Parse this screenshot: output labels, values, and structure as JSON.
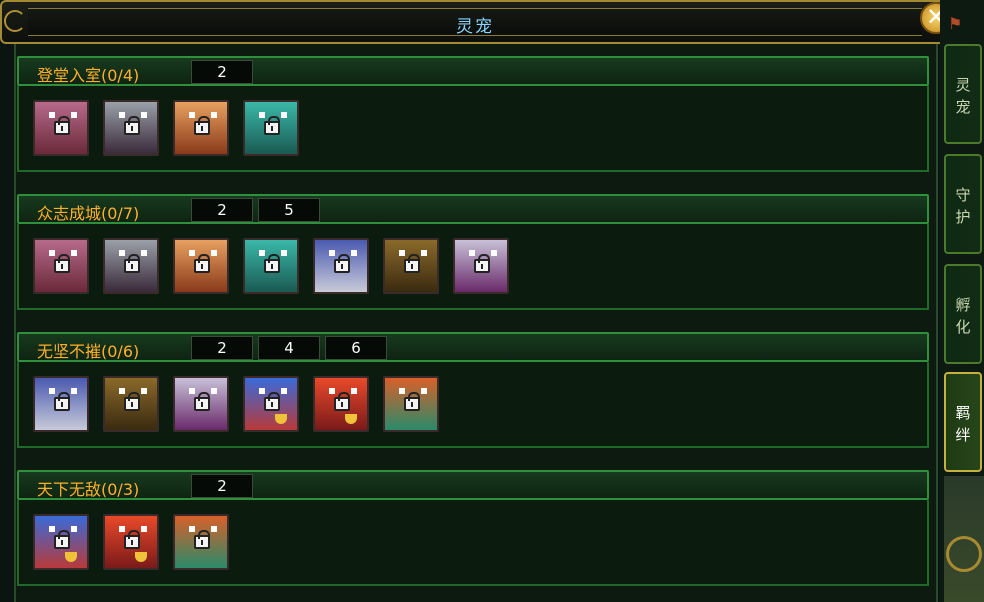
{
  "window": {
    "title": "灵宠"
  },
  "colors": {
    "accent_gold": "#a58a35",
    "group_name": "#ffb02a",
    "header_green": "#2f8f3a",
    "title_blue": "#8ad4ff"
  },
  "icons": {
    "close": "close-icon",
    "pet_lock": "lock-icon"
  },
  "sidebar": {
    "tabs": [
      {
        "label": "灵\n宠"
      },
      {
        "label": "守\n护"
      },
      {
        "label": "孵\n化"
      },
      {
        "label": "羁\n绊",
        "active": true
      }
    ]
  },
  "groups": [
    {
      "name": "登堂入室(0/4)",
      "tags": [
        "2"
      ],
      "pets": [
        "pink-pig",
        "white-fox",
        "orange-fox",
        "cyan-cat"
      ]
    },
    {
      "name": "众志成城(0/7)",
      "tags": [
        "2",
        "5"
      ],
      "pets": [
        "pink-pig",
        "white-fox",
        "orange-fox",
        "cyan-cat",
        "blue-wolf",
        "gold-bear",
        "feathered-mage"
      ]
    },
    {
      "name": "无坚不摧(0/6)",
      "tags": [
        "2",
        "4",
        "6"
      ],
      "pets": [
        "blue-wolf",
        "gold-bear",
        "feathered-mage",
        "blue-phoenix",
        "red-phoenix",
        "green-dragon"
      ]
    },
    {
      "name": "天下无敌(0/3)",
      "tags": [
        "2"
      ],
      "pets": [
        "blue-phoenix",
        "red-phoenix",
        "green-dragon"
      ]
    }
  ]
}
